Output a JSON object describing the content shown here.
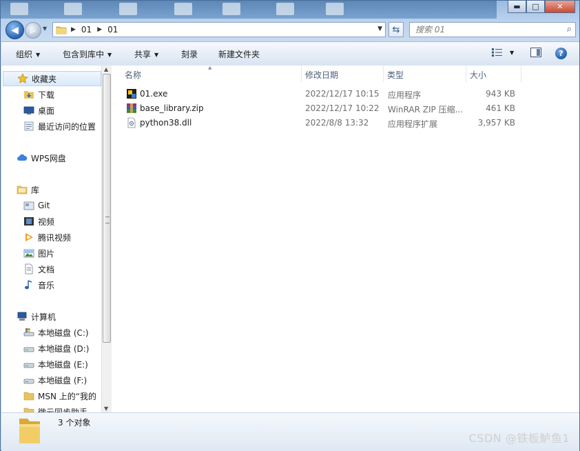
{
  "window": {
    "controls": {
      "minimize": "▬",
      "maximize": "□",
      "close": "✕"
    }
  },
  "address": {
    "crumbs": [
      "01",
      "01"
    ]
  },
  "search": {
    "placeholder": "搜索 01"
  },
  "toolbar": {
    "organize": "组织",
    "include_in_library": "包含到库中",
    "share": "共享",
    "burn": "刻录",
    "new_folder": "新建文件夹"
  },
  "nav": {
    "favorites": "收藏夹",
    "downloads": "下载",
    "desktop": "桌面",
    "recent": "最近访问的位置",
    "wps": "WPS网盘",
    "libraries": "库",
    "git": "Git",
    "videos": "视频",
    "tencent_video": "腾讯视频",
    "pictures": "图片",
    "documents": "文档",
    "music": "音乐",
    "computer": "计算机",
    "drive_c": "本地磁盘 (C:)",
    "drive_d": "本地磁盘 (D:)",
    "drive_e": "本地磁盘 (E:)",
    "drive_f": "本地磁盘 (F:)",
    "msn": "MSN 上的“我的",
    "wei_yun": "微云同步助手"
  },
  "columns": {
    "name": "名称",
    "date": "修改日期",
    "type": "类型",
    "size": "大小"
  },
  "files": [
    {
      "name": "01.exe",
      "date": "2022/12/17 10:15",
      "type": "应用程序",
      "size": "943 KB",
      "icon": "exe-icon"
    },
    {
      "name": "base_library.zip",
      "date": "2022/12/17 10:22",
      "type": "WinRAR ZIP 压缩...",
      "size": "461 KB",
      "icon": "winrar-zip-icon"
    },
    {
      "name": "python38.dll",
      "date": "2022/8/8 13:32",
      "type": "应用程序扩展",
      "size": "3,957 KB",
      "icon": "dll-icon"
    }
  ],
  "details": {
    "count": "3 个对象"
  },
  "watermark": "CSDN @铁板鲈鱼1",
  "colors": {
    "accent": "#2a63b6",
    "folder": "#e8c460",
    "toolbar_bg": "#e5edf7"
  }
}
